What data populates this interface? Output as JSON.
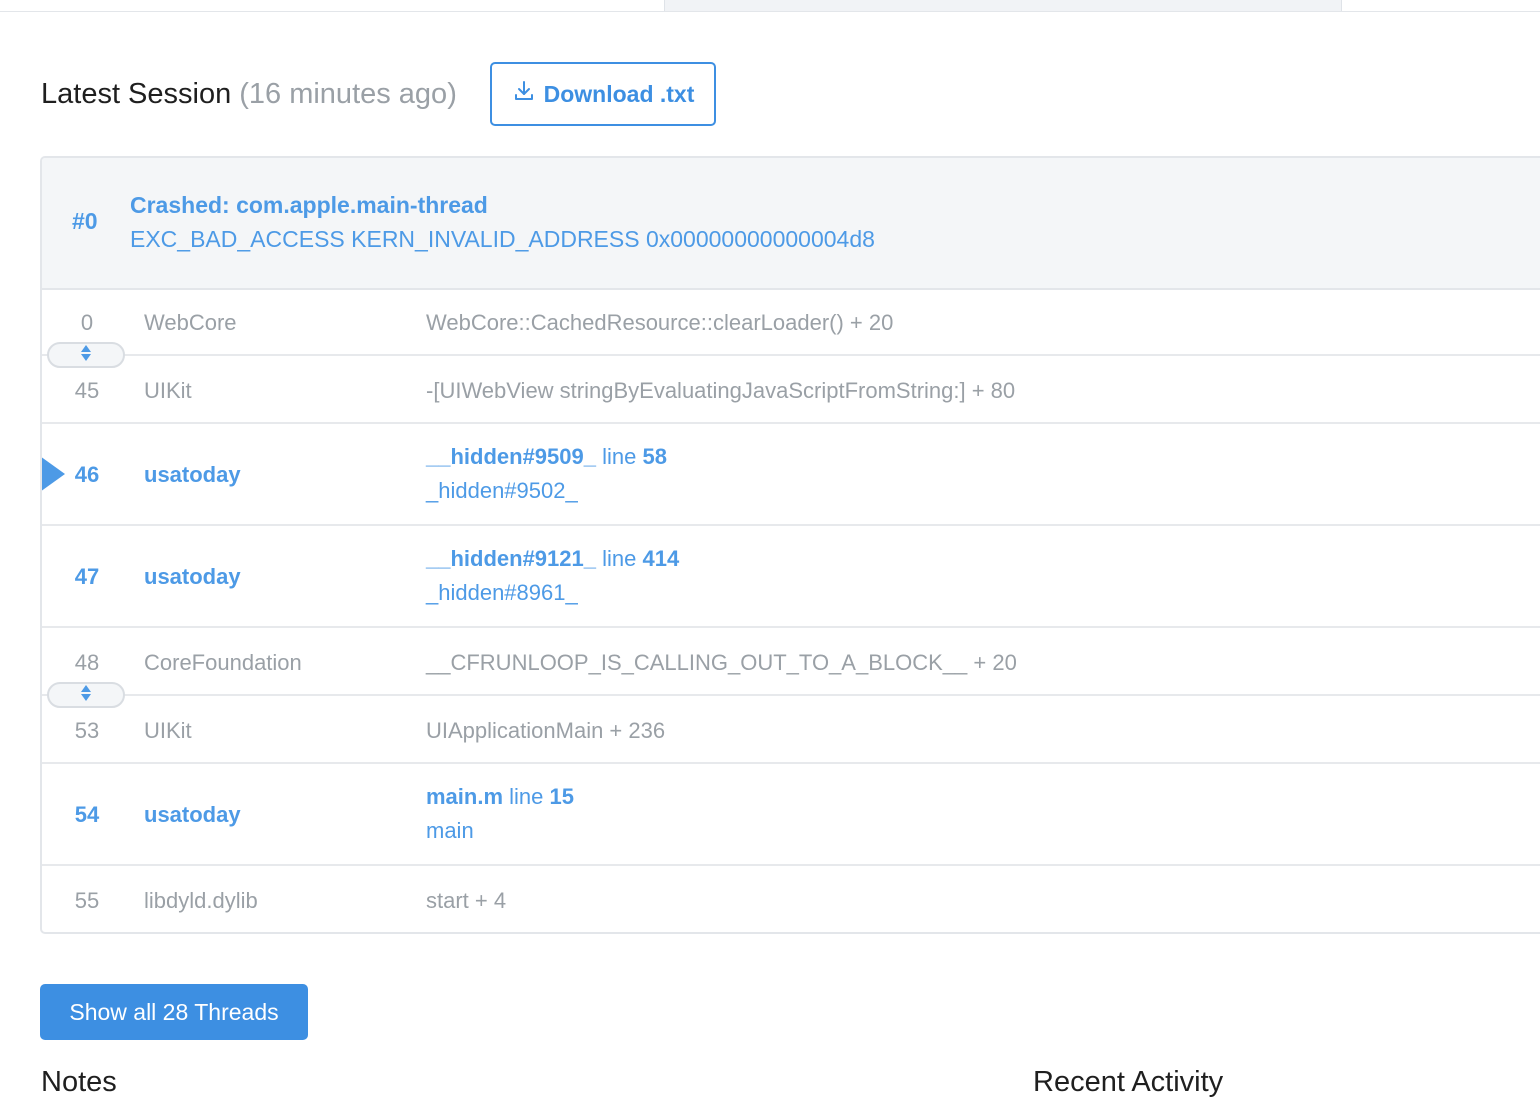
{
  "session": {
    "title": "Latest Session",
    "ago": "(16 minutes ago)",
    "download_label": "Download .txt"
  },
  "crash": {
    "index": "#0",
    "title": "Crashed: com.apple.main-thread",
    "reason": "EXC_BAD_ACCESS KERN_INVALID_ADDRESS 0x00000000000004d8"
  },
  "frames": [
    {
      "num": "0",
      "lib": "WebCore",
      "symbol": "WebCore::CachedResource::clearLoader() + 20"
    },
    {
      "num": "45",
      "lib": "UIKit",
      "symbol": "-[UIWebView stringByEvaluatingJavaScriptFromString:] + 80"
    },
    {
      "num": "46",
      "lib": "usatoday",
      "file": "__hidden#9509_",
      "line_word": "line",
      "line": "58",
      "func": "_hidden#9502_"
    },
    {
      "num": "47",
      "lib": "usatoday",
      "file": "__hidden#9121_",
      "line_word": "line",
      "line": "414",
      "func": "_hidden#8961_"
    },
    {
      "num": "48",
      "lib": "CoreFoundation",
      "symbol": "__CFRUNLOOP_IS_CALLING_OUT_TO_A_BLOCK__ + 20"
    },
    {
      "num": "53",
      "lib": "UIKit",
      "symbol": "UIApplicationMain + 236"
    },
    {
      "num": "54",
      "lib": "usatoday",
      "file": "main.m",
      "line_word": "line",
      "line": "15",
      "func": "main"
    },
    {
      "num": "55",
      "lib": "libdyld.dylib",
      "symbol": "start + 4"
    }
  ],
  "threads_button": "Show all 28 Threads",
  "bottom": {
    "left_heading": "Notes",
    "right_heading": "Recent Activity"
  },
  "colors": {
    "accent": "#3d8fe2",
    "link": "#4d9ae6",
    "muted": "#9aa0a6",
    "border": "#e3e6ea"
  },
  "icons": [
    "download-icon",
    "expand-frames-icon",
    "current-frame-marker"
  ]
}
